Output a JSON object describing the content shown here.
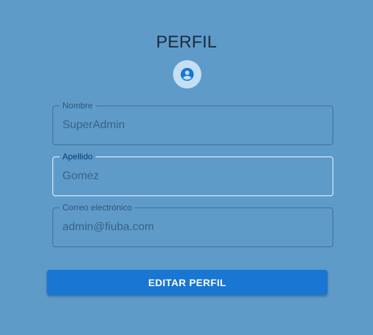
{
  "profile": {
    "title": "PERFIL",
    "avatar_icon": "account-circle-icon",
    "avatar_bg": "#c5dff5",
    "avatar_color": "#1976d2"
  },
  "form": {
    "nombre": {
      "label": "Nombre",
      "value": "SuperAdmin"
    },
    "apellido": {
      "label": "Apellido",
      "value": "Gomez"
    },
    "correo": {
      "label": "Correo electrónico",
      "value": "admin@fiuba.com"
    }
  },
  "actions": {
    "edit_label": "EDITAR PERFIL"
  },
  "colors": {
    "background": "#5f9bc9",
    "primary": "#1976d2"
  }
}
